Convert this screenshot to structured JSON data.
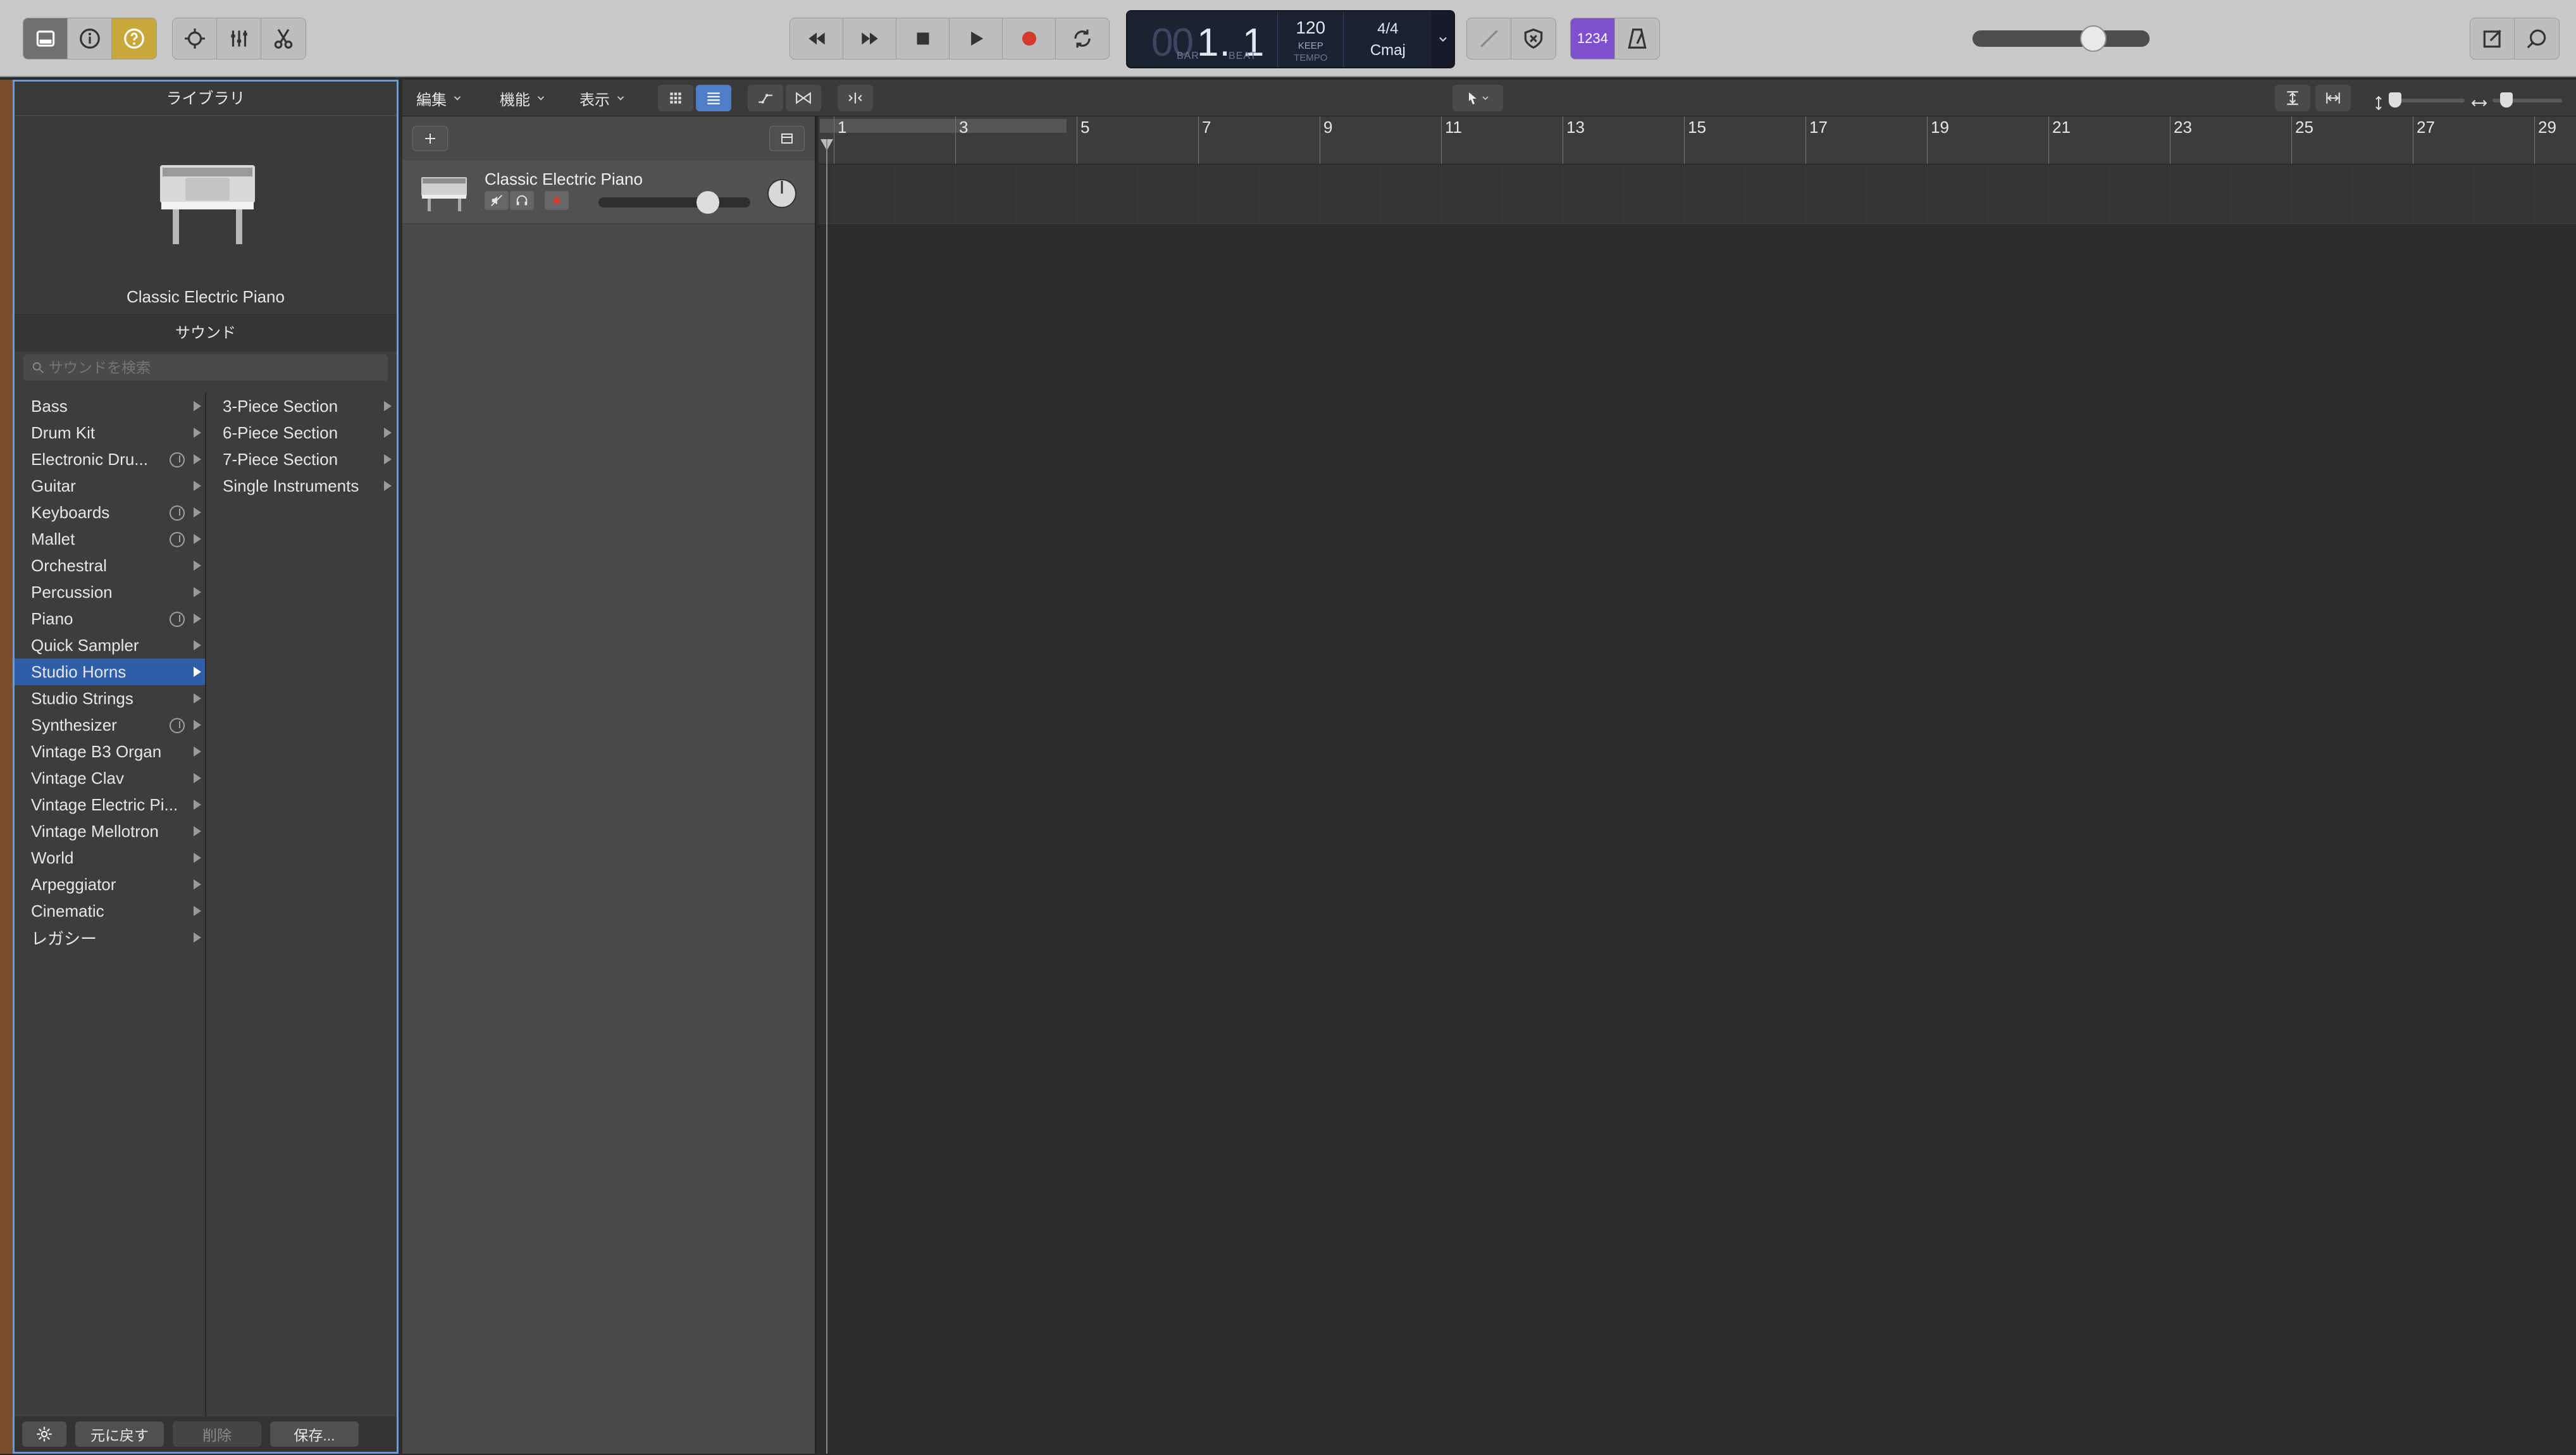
{
  "library": {
    "header": "ライブラリ",
    "preview_name": "Classic Electric Piano",
    "section_label": "サウンド",
    "search_placeholder": "サウンドを検索",
    "categories": [
      {
        "label": "Bass",
        "download": false
      },
      {
        "label": "Drum Kit",
        "download": false
      },
      {
        "label": "Electronic Dru...",
        "download": true
      },
      {
        "label": "Guitar",
        "download": false
      },
      {
        "label": "Keyboards",
        "download": true
      },
      {
        "label": "Mallet",
        "download": true
      },
      {
        "label": "Orchestral",
        "download": false
      },
      {
        "label": "Percussion",
        "download": false
      },
      {
        "label": "Piano",
        "download": true
      },
      {
        "label": "Quick Sampler",
        "download": false
      },
      {
        "label": "Studio Horns",
        "download": false,
        "selected": true
      },
      {
        "label": "Studio Strings",
        "download": false
      },
      {
        "label": "Synthesizer",
        "download": true
      },
      {
        "label": "Vintage B3 Organ",
        "download": false
      },
      {
        "label": "Vintage Clav",
        "download": false
      },
      {
        "label": "Vintage Electric Pi...",
        "download": false
      },
      {
        "label": "Vintage Mellotron",
        "download": false
      },
      {
        "label": "World",
        "download": false
      },
      {
        "label": "Arpeggiator",
        "download": false
      },
      {
        "label": "Cinematic",
        "download": false
      },
      {
        "label": "レガシー",
        "download": false
      }
    ],
    "subcategories": [
      "3-Piece Section",
      "6-Piece Section",
      "7-Piece Section",
      "Single Instruments"
    ],
    "footer": {
      "revert": "元に戻す",
      "delete": "削除",
      "save": "保存..."
    }
  },
  "lcd": {
    "position_dim": "00",
    "position": "1. 1",
    "bar_label": "BAR",
    "beat_label": "BEAT",
    "tempo": "120",
    "tempo_mode": "KEEP",
    "tempo_label": "TEMPO",
    "signature": "4/4",
    "key": "Cmaj",
    "count_in": "1234"
  },
  "tracks_toolbar": {
    "edit": "編集",
    "functions": "機能",
    "view": "表示"
  },
  "track": {
    "name": "Classic Electric Piano"
  },
  "ruler": {
    "bars": [
      "1",
      "3",
      "5",
      "7",
      "9",
      "11",
      "13",
      "15",
      "17",
      "19",
      "21",
      "23",
      "25",
      "27",
      "29"
    ]
  },
  "colors": {
    "selection": "#2e5fa8",
    "library_border": "#6b9bd6",
    "count_in_active": "#7e4fcf",
    "help_active": "#c8a83a",
    "record": "#d33a2c"
  }
}
